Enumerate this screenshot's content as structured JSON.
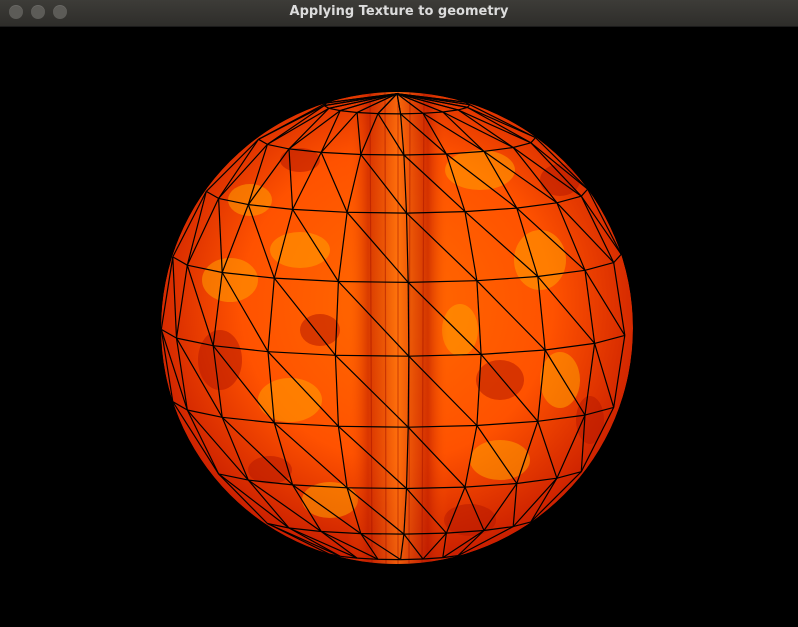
{
  "window": {
    "title": "Applying Texture to geometry",
    "controls": [
      "close-icon",
      "minimize-icon",
      "maximize-icon"
    ]
  },
  "scene": {
    "object": "sphere",
    "colors": {
      "background": "#000000",
      "texture_dark": "#b71800",
      "texture_mid": "#ff5a00",
      "texture_light": "#ffa000",
      "wireframe": "#000000"
    }
  }
}
